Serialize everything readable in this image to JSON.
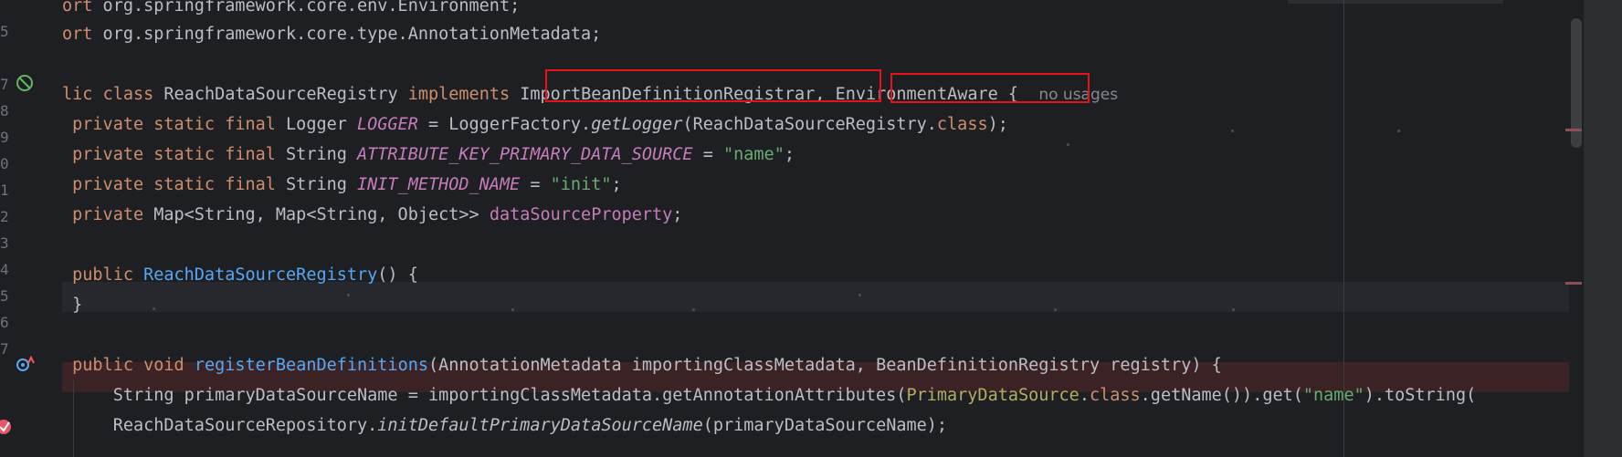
{
  "gutter": {
    "line_numbers": [
      "",
      "5",
      "",
      "7",
      "8",
      "9",
      "0",
      "1",
      "2",
      "3",
      "4",
      "5",
      "6",
      "7",
      ""
    ]
  },
  "code": {
    "l1_kw": "ort",
    "l1_rest": " org.springframework.core.env.Environment;",
    "l2_kw": "ort",
    "l2_rest": " org.springframework.core.type.AnnotationMetadata;",
    "l3_kw1": "lic",
    "l3_kw2": "class",
    "l3_name": "ReachDataSourceRegistry",
    "l3_kw3": "implements",
    "l3_iface1": "ImportBeanDefinitionRegistrar",
    "l3_comma": ",",
    "l3_iface2": "EnvironmentAware",
    "l3_brace": "{",
    "l3_hint": "no usages",
    "l4_kw": "private static final",
    "l4_type": "Logger",
    "l4_const": "LOGGER",
    "l4_eq": "=",
    "l4_call1": "LoggerFactory.",
    "l4_call2": "getLogger",
    "l4_arg": "(ReachDataSourceRegistry.",
    "l4_class_kw": "class",
    "l4_end": ");",
    "l5_kw": "private static final",
    "l5_type": "String",
    "l5_const": "ATTRIBUTE_KEY_PRIMARY_DATA_SOURCE",
    "l5_eq": "=",
    "l5_str": "\"name\"",
    "l5_end": ";",
    "l6_kw": "private static final",
    "l6_type": "String",
    "l6_const": "INIT_METHOD_NAME",
    "l6_eq": "=",
    "l6_str": "\"init\"",
    "l6_end": ";",
    "l7_kw": "private",
    "l7_type": "Map<String, Map<String, Object>>",
    "l7_field": "dataSourceProperty",
    "l7_end": ";",
    "l9_kw": "public",
    "l9_fn": "ReachDataSourceRegistry",
    "l9_end": "() {",
    "l10": "}",
    "l12_kw1": "public",
    "l12_kw2": "void",
    "l12_fn": "registerBeanDefinitions",
    "l12_params": "(AnnotationMetadata importingClassMetadata, BeanDefinitionRegistry registry) {",
    "l13_a": "String primaryDataSourceName = importingClassMetadata.getAnnotationAttributes(",
    "l13_ann": "PrimaryDataSource",
    "l13_dot": ".",
    "l13_class_kw": "class",
    "l13_b": ".getName()).get(",
    "l13_str": "\"name\"",
    "l13_c": ").toString(",
    "l14_a": "ReachDataSourceRepository.",
    "l14_fn": "initDefaultPrimaryDataSourceName",
    "l14_b": "(primaryDataSourceName);"
  },
  "icons": {
    "line7": "bean-no-entry-icon",
    "line13": "implementing-method-icon",
    "line14": "breakpoint-icon"
  },
  "colors": {
    "background": "#1e1f22",
    "keyword": "#cf8e6d",
    "string": "#6aab73",
    "constant": "#c77dbb",
    "function": "#56a8f5",
    "annotation_box": "#e8121b"
  }
}
